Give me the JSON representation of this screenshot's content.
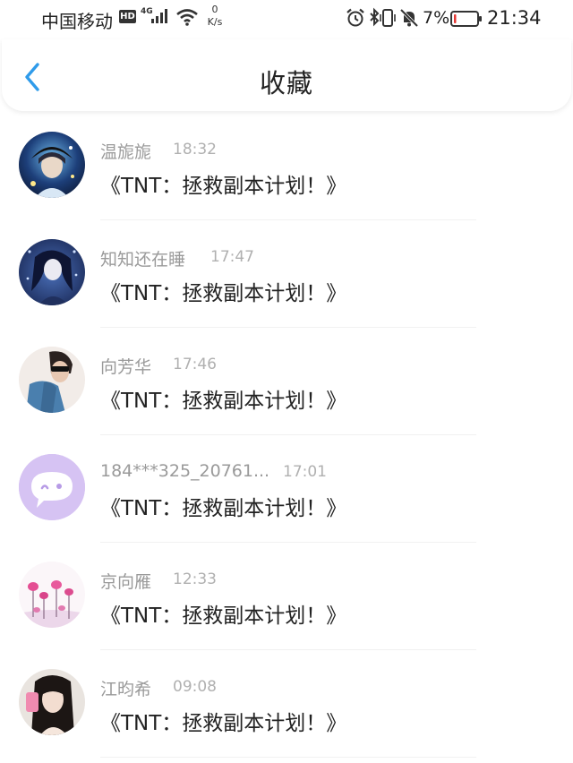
{
  "status_bar": {
    "carrier": "中国移动",
    "hd_badge": "HD",
    "network_type": "4G",
    "net_speed_value": "0",
    "net_speed_unit": "K/s",
    "battery_percent": "7%",
    "time": "21:34",
    "battery_level": 0.07,
    "battery_color": "#e53935"
  },
  "header": {
    "title": "收藏",
    "back_icon": "chevron-left-icon",
    "accent_color": "#2f9bea"
  },
  "favorites": [
    {
      "name": "温旎旎",
      "time": "18:32",
      "title": "《TNT：拯救副本计划！》",
      "avatar": "anime-boy-avatar"
    },
    {
      "name": "知知还在睡",
      "time": "17:47",
      "title": "《TNT：拯救副本计划！》",
      "avatar": "anime-girl-avatar"
    },
    {
      "name": "向芳华",
      "time": "17:46",
      "title": "《TNT：拯救副本计划！》",
      "avatar": "photo-boy-avatar"
    },
    {
      "name": "184***325_20761...",
      "time": "17:01",
      "title": "《TNT：拯救副本计划！》",
      "avatar": "default-chat-avatar"
    },
    {
      "name": "京向雁",
      "time": "12:33",
      "title": "《TNT：拯救副本计划！》",
      "avatar": "flowers-avatar"
    },
    {
      "name": "江昀希",
      "time": "09:08",
      "title": "《TNT：拯救副本计划！》",
      "avatar": "photo-girl-avatar"
    }
  ]
}
